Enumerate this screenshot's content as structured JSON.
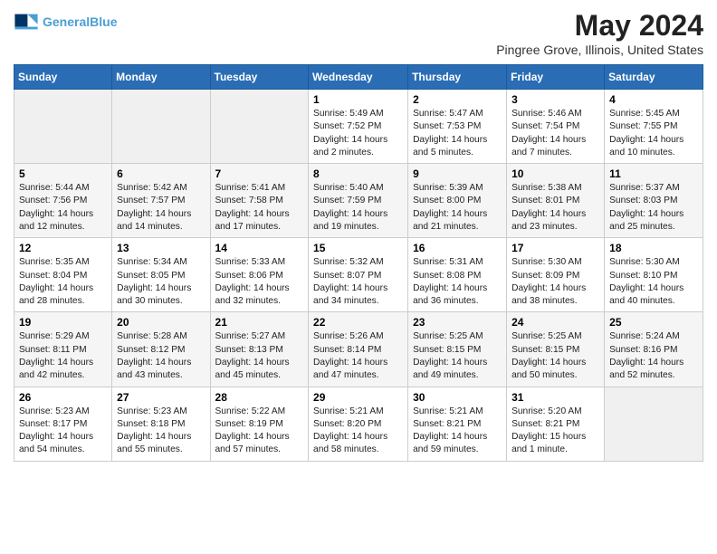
{
  "header": {
    "logo_line1": "General",
    "logo_line2": "Blue",
    "title": "May 2024",
    "location": "Pingree Grove, Illinois, United States"
  },
  "days_of_week": [
    "Sunday",
    "Monday",
    "Tuesday",
    "Wednesday",
    "Thursday",
    "Friday",
    "Saturday"
  ],
  "weeks": [
    [
      {
        "day": "",
        "info": ""
      },
      {
        "day": "",
        "info": ""
      },
      {
        "day": "",
        "info": ""
      },
      {
        "day": "1",
        "info": "Sunrise: 5:49 AM\nSunset: 7:52 PM\nDaylight: 14 hours\nand 2 minutes."
      },
      {
        "day": "2",
        "info": "Sunrise: 5:47 AM\nSunset: 7:53 PM\nDaylight: 14 hours\nand 5 minutes."
      },
      {
        "day": "3",
        "info": "Sunrise: 5:46 AM\nSunset: 7:54 PM\nDaylight: 14 hours\nand 7 minutes."
      },
      {
        "day": "4",
        "info": "Sunrise: 5:45 AM\nSunset: 7:55 PM\nDaylight: 14 hours\nand 10 minutes."
      }
    ],
    [
      {
        "day": "5",
        "info": "Sunrise: 5:44 AM\nSunset: 7:56 PM\nDaylight: 14 hours\nand 12 minutes."
      },
      {
        "day": "6",
        "info": "Sunrise: 5:42 AM\nSunset: 7:57 PM\nDaylight: 14 hours\nand 14 minutes."
      },
      {
        "day": "7",
        "info": "Sunrise: 5:41 AM\nSunset: 7:58 PM\nDaylight: 14 hours\nand 17 minutes."
      },
      {
        "day": "8",
        "info": "Sunrise: 5:40 AM\nSunset: 7:59 PM\nDaylight: 14 hours\nand 19 minutes."
      },
      {
        "day": "9",
        "info": "Sunrise: 5:39 AM\nSunset: 8:00 PM\nDaylight: 14 hours\nand 21 minutes."
      },
      {
        "day": "10",
        "info": "Sunrise: 5:38 AM\nSunset: 8:01 PM\nDaylight: 14 hours\nand 23 minutes."
      },
      {
        "day": "11",
        "info": "Sunrise: 5:37 AM\nSunset: 8:03 PM\nDaylight: 14 hours\nand 25 minutes."
      }
    ],
    [
      {
        "day": "12",
        "info": "Sunrise: 5:35 AM\nSunset: 8:04 PM\nDaylight: 14 hours\nand 28 minutes."
      },
      {
        "day": "13",
        "info": "Sunrise: 5:34 AM\nSunset: 8:05 PM\nDaylight: 14 hours\nand 30 minutes."
      },
      {
        "day": "14",
        "info": "Sunrise: 5:33 AM\nSunset: 8:06 PM\nDaylight: 14 hours\nand 32 minutes."
      },
      {
        "day": "15",
        "info": "Sunrise: 5:32 AM\nSunset: 8:07 PM\nDaylight: 14 hours\nand 34 minutes."
      },
      {
        "day": "16",
        "info": "Sunrise: 5:31 AM\nSunset: 8:08 PM\nDaylight: 14 hours\nand 36 minutes."
      },
      {
        "day": "17",
        "info": "Sunrise: 5:30 AM\nSunset: 8:09 PM\nDaylight: 14 hours\nand 38 minutes."
      },
      {
        "day": "18",
        "info": "Sunrise: 5:30 AM\nSunset: 8:10 PM\nDaylight: 14 hours\nand 40 minutes."
      }
    ],
    [
      {
        "day": "19",
        "info": "Sunrise: 5:29 AM\nSunset: 8:11 PM\nDaylight: 14 hours\nand 42 minutes."
      },
      {
        "day": "20",
        "info": "Sunrise: 5:28 AM\nSunset: 8:12 PM\nDaylight: 14 hours\nand 43 minutes."
      },
      {
        "day": "21",
        "info": "Sunrise: 5:27 AM\nSunset: 8:13 PM\nDaylight: 14 hours\nand 45 minutes."
      },
      {
        "day": "22",
        "info": "Sunrise: 5:26 AM\nSunset: 8:14 PM\nDaylight: 14 hours\nand 47 minutes."
      },
      {
        "day": "23",
        "info": "Sunrise: 5:25 AM\nSunset: 8:15 PM\nDaylight: 14 hours\nand 49 minutes."
      },
      {
        "day": "24",
        "info": "Sunrise: 5:25 AM\nSunset: 8:15 PM\nDaylight: 14 hours\nand 50 minutes."
      },
      {
        "day": "25",
        "info": "Sunrise: 5:24 AM\nSunset: 8:16 PM\nDaylight: 14 hours\nand 52 minutes."
      }
    ],
    [
      {
        "day": "26",
        "info": "Sunrise: 5:23 AM\nSunset: 8:17 PM\nDaylight: 14 hours\nand 54 minutes."
      },
      {
        "day": "27",
        "info": "Sunrise: 5:23 AM\nSunset: 8:18 PM\nDaylight: 14 hours\nand 55 minutes."
      },
      {
        "day": "28",
        "info": "Sunrise: 5:22 AM\nSunset: 8:19 PM\nDaylight: 14 hours\nand 57 minutes."
      },
      {
        "day": "29",
        "info": "Sunrise: 5:21 AM\nSunset: 8:20 PM\nDaylight: 14 hours\nand 58 minutes."
      },
      {
        "day": "30",
        "info": "Sunrise: 5:21 AM\nSunset: 8:21 PM\nDaylight: 14 hours\nand 59 minutes."
      },
      {
        "day": "31",
        "info": "Sunrise: 5:20 AM\nSunset: 8:21 PM\nDaylight: 15 hours\nand 1 minute."
      },
      {
        "day": "",
        "info": ""
      }
    ]
  ]
}
